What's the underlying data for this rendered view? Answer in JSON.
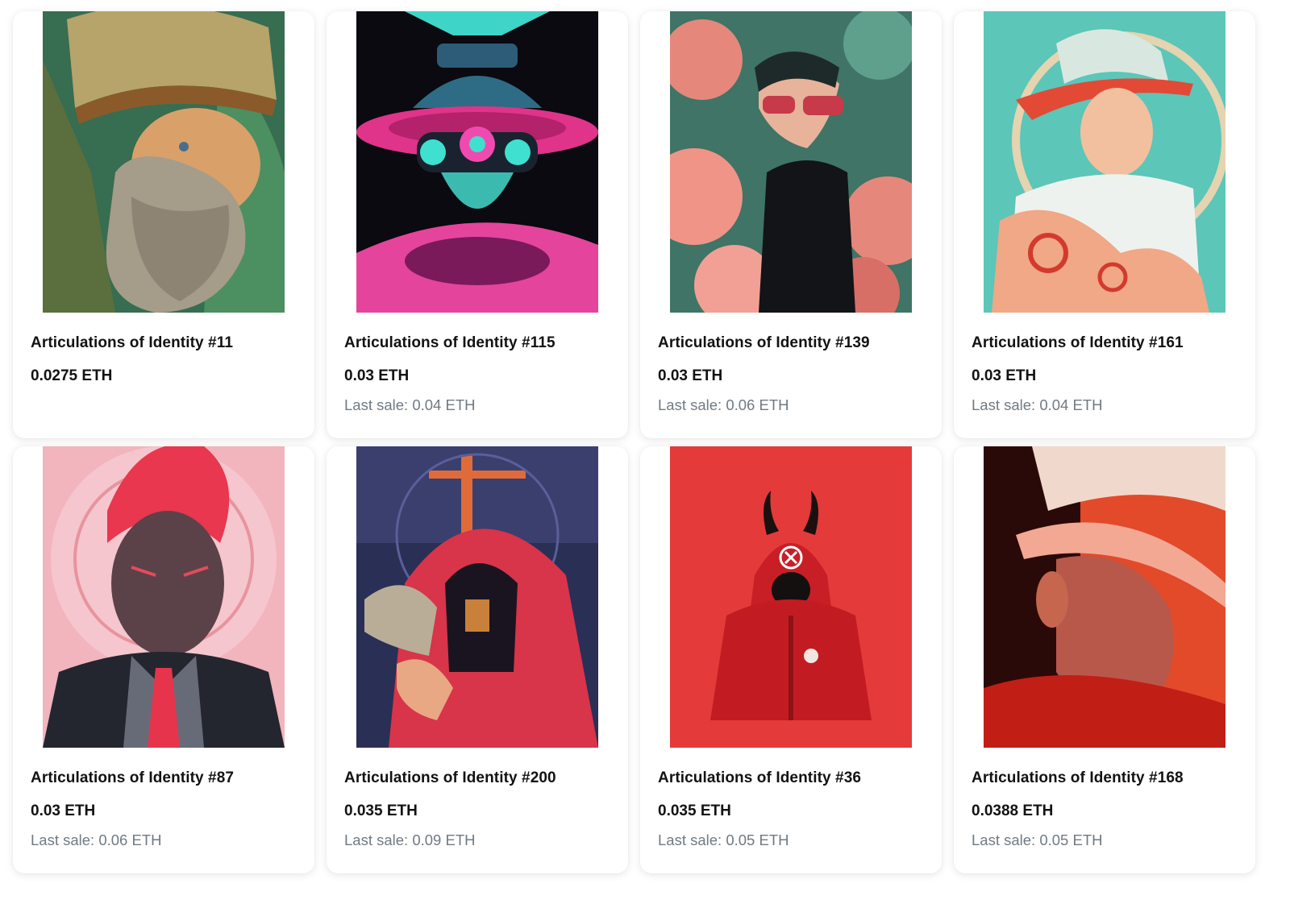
{
  "items": [
    {
      "name": "Articulations of Identity #11",
      "price": "0.0275 ETH",
      "last_sale_label": "",
      "last_sale": "",
      "art": "bearded-warrior-portrait"
    },
    {
      "name": "Articulations of Identity #115",
      "price": "0.03 ETH",
      "last_sale_label": "Last sale:",
      "last_sale": "0.04 ETH",
      "art": "neon-robot-hat-portrait"
    },
    {
      "name": "Articulations of Identity #139",
      "price": "0.03 ETH",
      "last_sale_label": "Last sale:",
      "last_sale": "0.06 ETH",
      "art": "sunglasses-floral-portrait"
    },
    {
      "name": "Articulations of Identity #161",
      "price": "0.03 ETH",
      "last_sale_label": "Last sale:",
      "last_sale": "0.04 ETH",
      "art": "headband-fighter-portrait"
    },
    {
      "name": "Articulations of Identity #87",
      "price": "0.03 ETH",
      "last_sale_label": "Last sale:",
      "last_sale": "0.06 ETH",
      "art": "red-hair-suit-portrait"
    },
    {
      "name": "Articulations of Identity #200",
      "price": "0.035 ETH",
      "last_sale_label": "Last sale:",
      "last_sale": "0.09 ETH",
      "art": "red-hooded-pixel-figure"
    },
    {
      "name": "Articulations of Identity #36",
      "price": "0.035 ETH",
      "last_sale_label": "Last sale:",
      "last_sale": "0.05 ETH",
      "art": "horned-hood-figure"
    },
    {
      "name": "Articulations of Identity #168",
      "price": "0.0388 ETH",
      "last_sale_label": "Last sale:",
      "last_sale": "0.05 ETH",
      "art": "cap-profile-portrait"
    }
  ],
  "colors": {
    "text_primary": "#121212",
    "text_secondary": "#707a83",
    "card_bg": "#ffffff"
  }
}
